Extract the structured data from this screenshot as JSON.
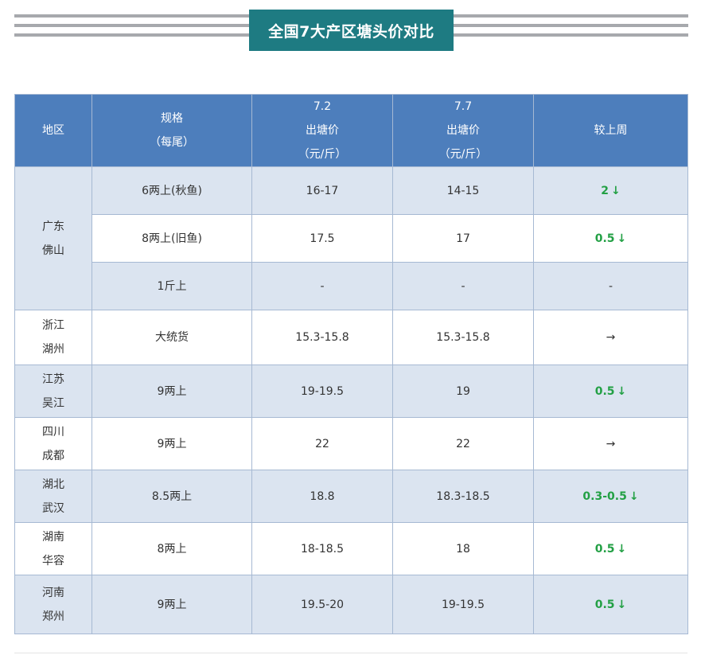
{
  "title": "全国7大产区塘头价对比",
  "table": {
    "headers": {
      "region": "地区",
      "spec": [
        "规格",
        "（每尾）"
      ],
      "price1": [
        "7.2",
        "出塘价",
        "（元/斤）"
      ],
      "price2": [
        "7.7",
        "出塘价",
        "（元/斤）"
      ],
      "change": "较上周"
    },
    "groups": [
      {
        "region": [
          "广东",
          "佛山"
        ],
        "rows": [
          {
            "spec": "6两上(秋鱼)",
            "p1": "16-17",
            "p2": "14-15",
            "change": "2",
            "dir": "down"
          },
          {
            "spec": "8两上(旧鱼)",
            "p1": "17.5",
            "p2": "17",
            "change": "0.5",
            "dir": "down"
          },
          {
            "spec": "1斤上",
            "p1": "-",
            "p2": "-",
            "change": "-",
            "dir": "none"
          }
        ]
      },
      {
        "region": [
          "浙江",
          "湖州"
        ],
        "rows": [
          {
            "spec": "大统货",
            "p1": "15.3-15.8",
            "p2": "15.3-15.8",
            "change": "",
            "dir": "flat"
          }
        ]
      },
      {
        "region": [
          "江苏",
          "吴江"
        ],
        "rows": [
          {
            "spec": "9两上",
            "p1": "19-19.5",
            "p2": "19",
            "change": "0.5",
            "dir": "down"
          }
        ]
      },
      {
        "region": [
          "四川",
          "成都"
        ],
        "rows": [
          {
            "spec": "9两上",
            "p1": "22",
            "p2": "22",
            "change": "",
            "dir": "flat"
          }
        ]
      },
      {
        "region": [
          "湖北",
          "武汉"
        ],
        "rows": [
          {
            "spec": "8.5两上",
            "p1": "18.8",
            "p2": "18.3-18.5",
            "change": "0.3-0.5",
            "dir": "down"
          }
        ]
      },
      {
        "region": [
          "湖南",
          "华容"
        ],
        "rows": [
          {
            "spec": "8两上",
            "p1": "18-18.5",
            "p2": "18",
            "change": "0.5",
            "dir": "down"
          }
        ]
      },
      {
        "region": [
          "河南",
          "郑州"
        ],
        "rows": [
          {
            "spec": "9两上",
            "p1": "19.5-20",
            "p2": "19-19.5",
            "change": "0.5",
            "dir": "down"
          }
        ]
      }
    ]
  },
  "icons": {
    "down": "arrow-down-icon",
    "flat": "arrow-right-icon"
  },
  "colors": {
    "header_bg": "#4d7ebc",
    "title_bg": "#1e7b82",
    "row_shade": "#dbe4f0",
    "down": "#23a045"
  }
}
